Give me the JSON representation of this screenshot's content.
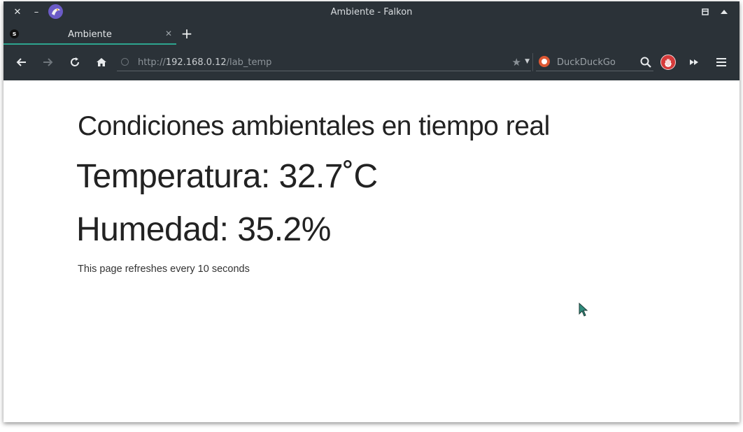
{
  "window": {
    "title": "Ambiente - Falkon"
  },
  "tabs": [
    {
      "label": "Ambiente",
      "favicon_letter": "s",
      "active": true
    }
  ],
  "navbar": {
    "url_scheme": "http://",
    "url_host": "192.168.0.12",
    "url_path": "/lab_temp",
    "search_engine": "DuckDuckGo"
  },
  "page": {
    "heading": "Condiciones ambientales en tiempo real",
    "temperature_line": "Temperatura: 32.7˚C",
    "humidity_line": "Humedad: 35.2%",
    "refresh_note": "This page refreshes every 10 seconds"
  },
  "icons": {
    "close": "close-icon",
    "minimize": "minimize-icon",
    "app": "falkon-logo-icon",
    "restore": "restore-icon",
    "maximize": "maximize-icon",
    "back": "back-arrow-icon",
    "forward": "forward-arrow-icon",
    "reload": "reload-icon",
    "home": "home-icon",
    "bookmark": "star-icon",
    "search": "search-icon",
    "adblock": "adblock-icon",
    "more_tools": "fast-forward-icon",
    "menu": "hamburger-menu-icon"
  },
  "colors": {
    "titlebar": "#2b3238",
    "tab_indicator": "#2ea58f",
    "page_bg": "#ffffff",
    "text": "#222222"
  }
}
